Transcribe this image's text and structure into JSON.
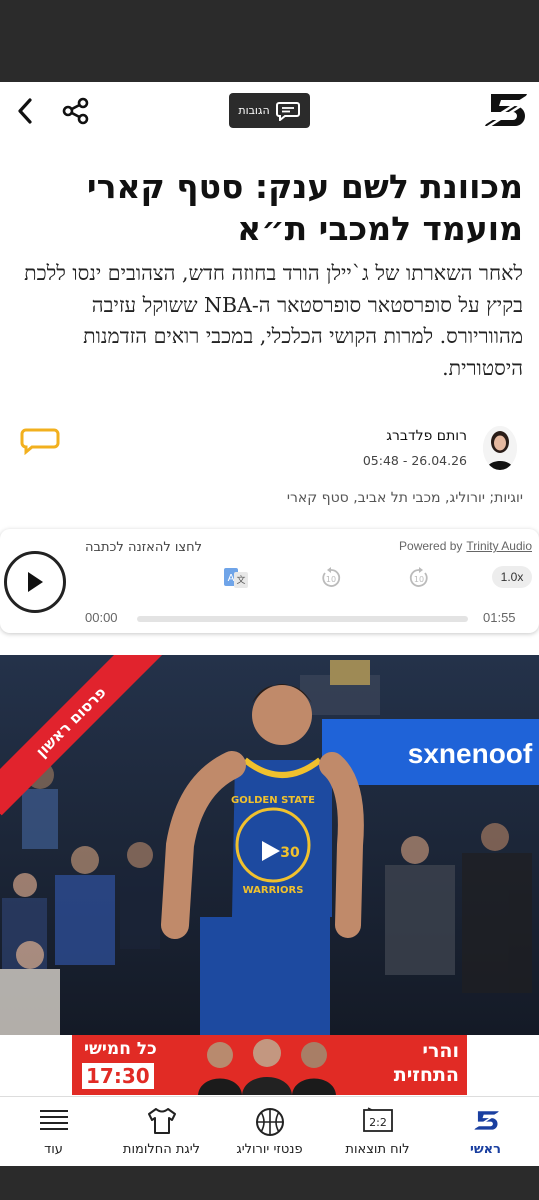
{
  "header": {
    "comments_label": "הגובות",
    "logo_text": "5"
  },
  "article": {
    "title": "מכוונת לשם ענק: סטף קארי מועמד למכבי ת״א",
    "subtitle": "לאחר השארתו של ג`יילן הורד בחוזה חדש, הצהובים ינסו ללכת בקיץ על סופרסטאר סופרסטאר ה-NBA ששוקל עזיבה מהווריורס. למרות הקושי הכלכלי, במכבי רואים הזדמנות היסטורית.",
    "author": "רותם פלדברג",
    "date": "05:48 - 26.04.26",
    "tags": "יוגיות; יורוליג, מכבי תל אביב, סטף קארי"
  },
  "audio": {
    "cta": "לחצו להאזנה לכתבה",
    "powered_by": "Powered by",
    "brand": "Trinity Audio",
    "speed": "1.0x",
    "current_time": "00:00",
    "total_time": "01:55",
    "progress": 0
  },
  "photo": {
    "ribbon": "פרסום ראשון"
  },
  "banner": {
    "right_line1": "והרי",
    "right_line2": "התחזית",
    "left_line1": "כל חמישי",
    "left_line2": "17:30"
  },
  "nav": {
    "items": [
      {
        "label": "ראשי",
        "icon": "logo-5-icon",
        "active": true
      },
      {
        "label": "לוח תוצאות",
        "icon": "scoreboard-icon"
      },
      {
        "label": "פנטזי יורוליג",
        "icon": "basketball-icon"
      },
      {
        "label": "ליגת החלומות",
        "icon": "shirt-icon"
      },
      {
        "label": "עוד",
        "icon": "menu-icon"
      }
    ]
  },
  "colors": {
    "accent_red": "#e12b25",
    "brand_blue": "#1a3fa0",
    "comment_yellow": "#f2b01e"
  }
}
